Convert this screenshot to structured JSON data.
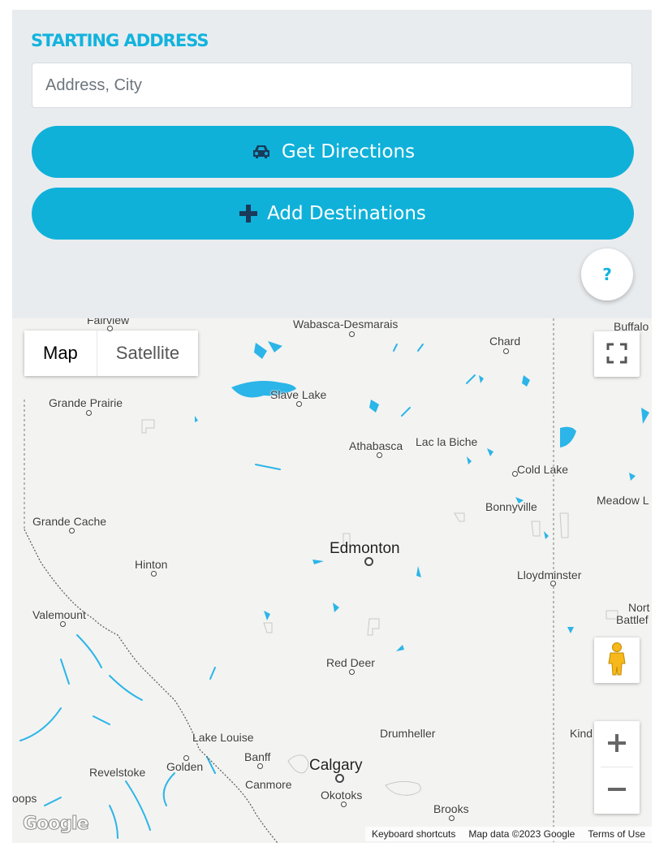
{
  "form": {
    "title": "STARTING ADDRESS",
    "address_placeholder": "Address, City",
    "get_directions_label": "Get Directions",
    "add_destinations_label": "Add Destinations",
    "help_label": "?"
  },
  "colors": {
    "accent": "#0fb1d9",
    "panel_bg": "#e9ecef",
    "water": "#2bb5e8"
  },
  "icons": {
    "directions": "car-icon",
    "add": "plus-icon",
    "fullscreen": "fullscreen-icon",
    "street_view": "pegman-icon",
    "zoom_in": "plus-icon",
    "zoom_out": "minus-icon"
  },
  "map": {
    "map_type_options": [
      "Map",
      "Satellite"
    ],
    "selected_map_type": "Map",
    "zoom_in_label": "+",
    "zoom_out_label": "−",
    "logo": "Google",
    "attribution": {
      "keyboard": "Keyboard shortcuts",
      "data": "Map data ©2023 Google",
      "terms": "Terms of Use"
    },
    "places": {
      "fairview": "Fairview",
      "wabasca": "Wabasca-Desmarais",
      "buffalo": "Buffalo",
      "chard": "Chard",
      "slave_lake": "Slave Lake",
      "grande_prairie": "Grande Prairie",
      "athabasca": "Athabasca",
      "lac_la_biche": "Lac la Biche",
      "cold_lake": "Cold Lake",
      "bonnyville": "Bonnyville",
      "meadow_lake": "Meadow L",
      "grande_cache": "Grande Cache",
      "edmonton": "Edmonton",
      "hinton": "Hinton",
      "lloydminster": "Lloydminster",
      "valemount": "Valemount",
      "north_battleford_1": "Nort",
      "north_battleford_2": "Battlef",
      "red_deer": "Red Deer",
      "lake_louise": "Lake Louise",
      "drumheller": "Drumheller",
      "kindersley": "Kind",
      "banff": "Banff",
      "golden": "Golden",
      "revelstoke": "Revelstoke",
      "calgary": "Calgary",
      "canmore": "Canmore",
      "okotoks": "Okotoks",
      "kamloops": "oops",
      "brooks": "Brooks"
    }
  }
}
